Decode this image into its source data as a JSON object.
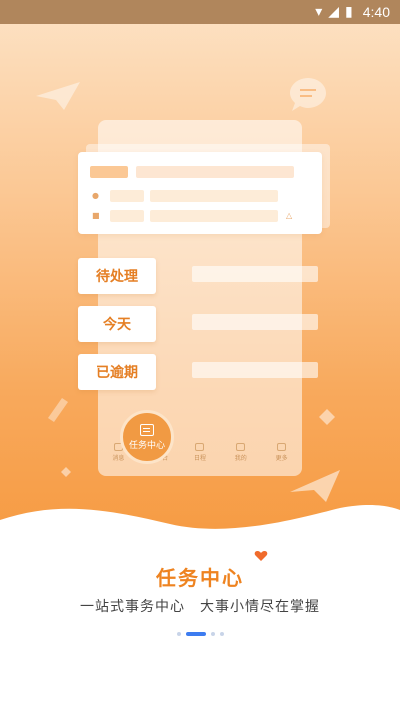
{
  "statusbar": {
    "time": "4:40"
  },
  "mockup": {
    "pills": [
      "待处理",
      "今天",
      "已逾期"
    ],
    "task_center_label": "任务中心",
    "nav_items": [
      "消息",
      "工作台",
      "日程",
      "我的",
      "更多"
    ]
  },
  "onboarding": {
    "title": "任务中心",
    "subtitle": "一站式事务中心　大事小情尽在掌握",
    "page_indicator": {
      "total": 4,
      "active": 2
    }
  },
  "colors": {
    "accent": "#ee8320",
    "indicator_active": "#3d7cf0",
    "gradient_top": "#fde3c6",
    "gradient_bottom": "#f6993f"
  }
}
